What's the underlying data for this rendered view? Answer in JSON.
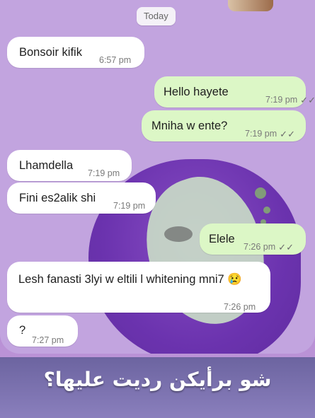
{
  "date_chip": "Today",
  "messages": [
    {
      "direction": "in",
      "text": "Bonsoir kifik",
      "time": "6:57 pm"
    },
    {
      "direction": "out",
      "text": "Hello hayete",
      "time": "7:19 pm",
      "ticks": "✓✓"
    },
    {
      "direction": "out",
      "text": "Mniha w ente?",
      "time": "7:19 pm",
      "ticks": "✓✓"
    },
    {
      "direction": "in",
      "text": "Lhamdella",
      "time": "7:19 pm"
    },
    {
      "direction": "in",
      "text": "Fini es2alik shi",
      "time": "7:19 pm"
    },
    {
      "direction": "out",
      "text": "Elele",
      "time": "7:26 pm",
      "ticks": "✓✓"
    },
    {
      "direction": "in",
      "text": "Lesh fanasti 3lyi w eltili l whitening mni7 😢",
      "time": "7:26 pm"
    },
    {
      "direction": "in",
      "text": "?",
      "time": "7:27 pm"
    }
  ],
  "caption": "شو برأيكن رديت عليها؟",
  "colors": {
    "chat_background": "#c2a4df",
    "incoming_bubble": "#ffffff",
    "outgoing_bubble": "#dcf7c6",
    "caption_background": "#7b72b0"
  }
}
